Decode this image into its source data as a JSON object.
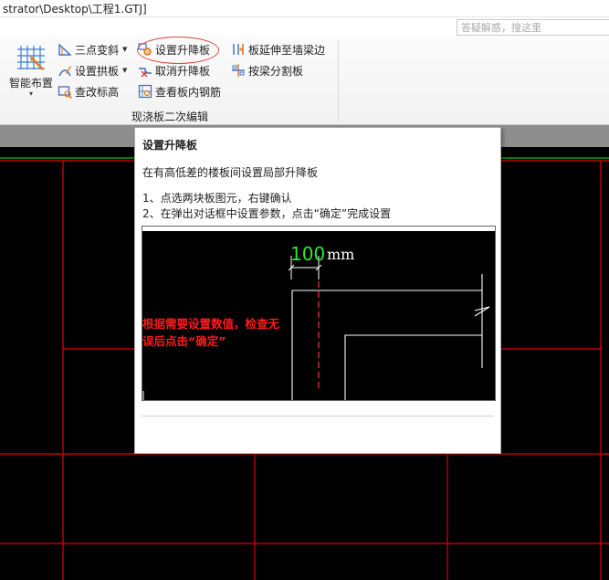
{
  "window": {
    "title_path": "strator\\Desktop\\工程1.GTJ]"
  },
  "search": {
    "placeholder": "答疑解惑，搜这里"
  },
  "ribbon": {
    "smart_layout": "智能布置",
    "three_point_slope": "三点变斜",
    "set_arch_slab": "设置拱板",
    "check_elevation": "查改标高",
    "set_raise_lower": "设置升降板",
    "cancel_raise_lower": "取消升降板",
    "view_slab_rebar": "查看板内钢筋",
    "extend_slab_to_wall": "板延伸至墙梁边",
    "split_by_beam": "按梁分割板",
    "group_label": "现浇板二次编辑"
  },
  "tooltip": {
    "title": "设置升降板",
    "description": "在有高低差的楼板间设置局部升降板",
    "step1": "1、点选两块板图元，右键确认",
    "step2": "2、在弹出对话框中设置参数，点击“确定”完成设置",
    "image": {
      "dimension_value": "100",
      "dimension_unit": "mm",
      "note": "根据需要设置数值，检查无误后点击“确定”"
    }
  },
  "colors": {
    "cad_background": "#000000",
    "cad_axis_red": "#e00000",
    "cad_green": "#00c800",
    "note_red": "#ff1a1a",
    "dimension_green": "#2ee82e",
    "highlight": "#e2463c"
  },
  "icons": {
    "smart_layout": "grid-layout-icon",
    "three_point_slope": "slope-icon",
    "set_arch_slab": "arch-pen-icon",
    "check_elevation": "elevation-check-icon",
    "set_raise_lower": "gear-slab-icon",
    "cancel_raise_lower": "cancel-slab-icon",
    "view_slab_rebar": "rebar-view-icon",
    "extend_slab_to_wall": "extend-icon",
    "split_by_beam": "split-icon"
  }
}
